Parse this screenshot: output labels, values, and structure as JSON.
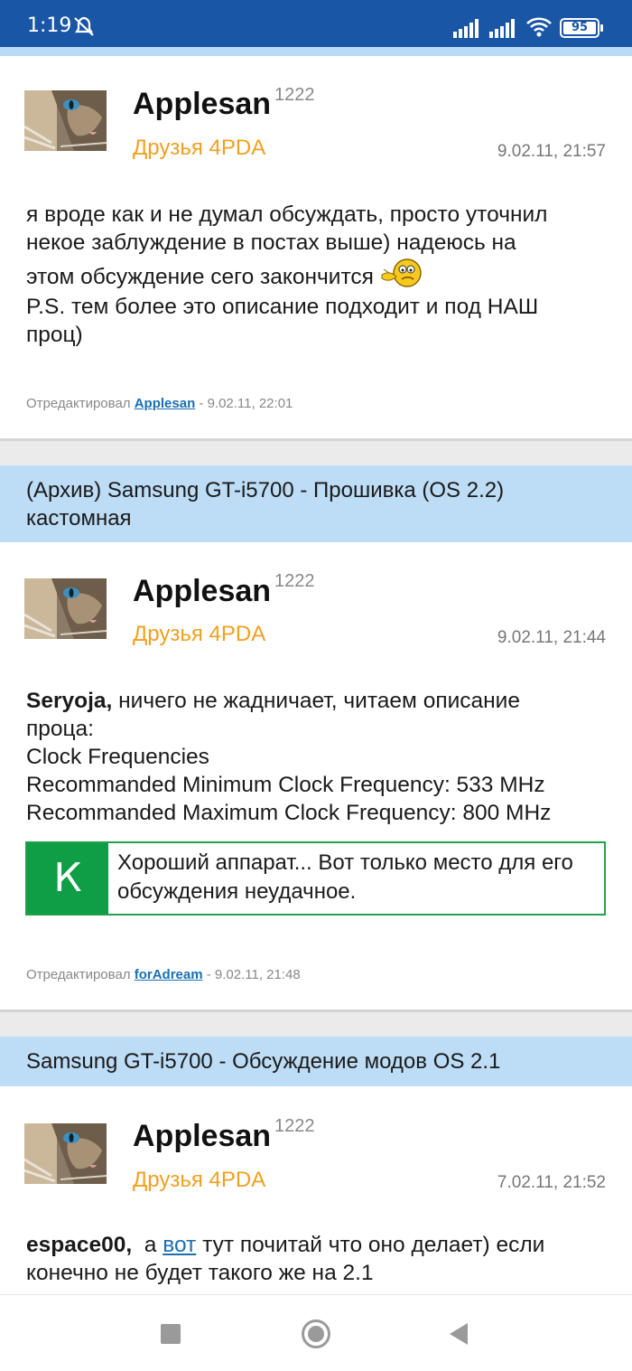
{
  "status": {
    "time": "1:19",
    "battery": "95",
    "icons": [
      "dnd-off-icon",
      "signal-icon",
      "signal-icon",
      "wifi-icon",
      "battery-icon"
    ]
  },
  "posts": [
    {
      "author": "Applesan",
      "rep": "1222",
      "group": "Друзья 4PDA",
      "date": "9.02.11, 21:57",
      "lines": [
        "я вроде как и не думал обсуждать, просто уточнил",
        "некое заблуждение в постах выше) надеюсь на",
        "этом обсуждение сего закончится",
        "P.S. тем более это описание подходит и под НАШ",
        "проц)"
      ],
      "edited_prefix": "Отредактировал",
      "edited_by": "Applesan",
      "edited_date": "- 9.02.11, 22:01"
    },
    {
      "topic": "(Архив) Samsung GT-i5700 - Прошивка (OS 2.2) кастомная",
      "author": "Applesan",
      "rep": "1222",
      "group": "Друзья 4PDA",
      "date": "9.02.11, 21:44",
      "mention": "Seryoja,",
      "lines": [
        "ничего не жадничает, читаем описание",
        "проца:",
        "Clock Frequencies",
        "Recommanded Minimum Clock Frequency: 533 MHz",
        "Recommanded Maximum Clock Frequency: 800 MHz"
      ],
      "moderator_letter": "К",
      "moderator_note": "Хороший аппарат... Вот только место для его обсуждения неудачное.",
      "edited_prefix": "Отредактировал",
      "edited_by": "forAdream",
      "edited_date": "- 9.02.11, 21:48"
    },
    {
      "topic": "Samsung GT-i5700 - Обсуждение модов OS 2.1",
      "author": "Applesan",
      "rep": "1222",
      "group": "Друзья 4PDA",
      "date": "7.02.11, 21:52",
      "mention": "espace00,",
      "pre_link": "а",
      "link": "вот",
      "post_link": "тут почитай что оно делает) если",
      "line2": "конечно не будет такого же на 2.1"
    }
  ],
  "navbar": {
    "icons": [
      "recent-apps-icon",
      "home-icon",
      "back-icon"
    ]
  }
}
